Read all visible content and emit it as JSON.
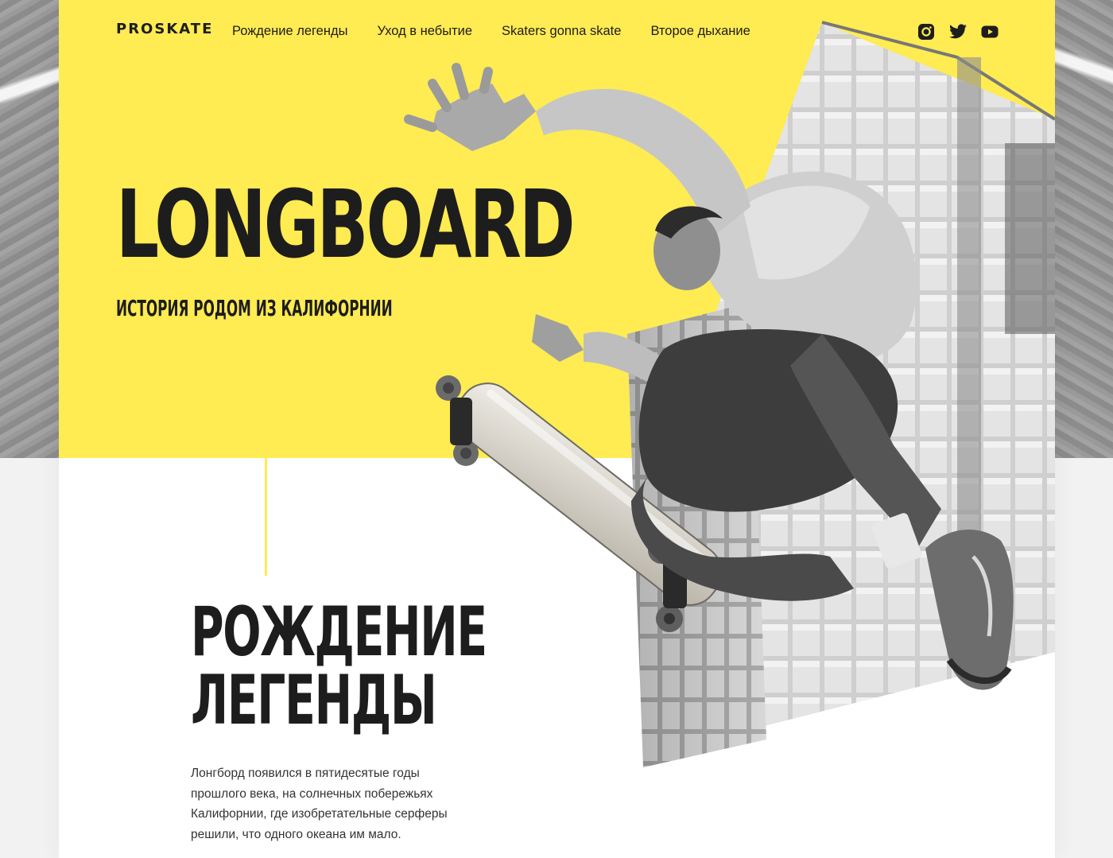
{
  "nav": {
    "logo": "PROSKATE",
    "links": [
      "Рождение легенды",
      "Уход в небытие",
      "Skaters gonna skate",
      "Второе дыхание"
    ],
    "social": [
      "instagram-icon",
      "twitter-icon",
      "youtube-icon"
    ]
  },
  "hero": {
    "title": "LONGBOARD",
    "subtitle": "ИСТОРИЯ РОДОМ ИЗ КАЛИФОРНИИ",
    "image": "skateboarder-jumping-photo"
  },
  "section": {
    "title_line1": "РОЖДЕНИЕ",
    "title_line2": "ЛЕГЕНДЫ",
    "text": "Лонгборд появился в пятидесятые годы прошлого века, на солнечных побережьях Калифорнии, где изобретательные серферы решили, что одного океана им мало."
  },
  "colors": {
    "accent": "#ffeb52",
    "text": "#1d1d1d",
    "background": "#ffffff"
  }
}
